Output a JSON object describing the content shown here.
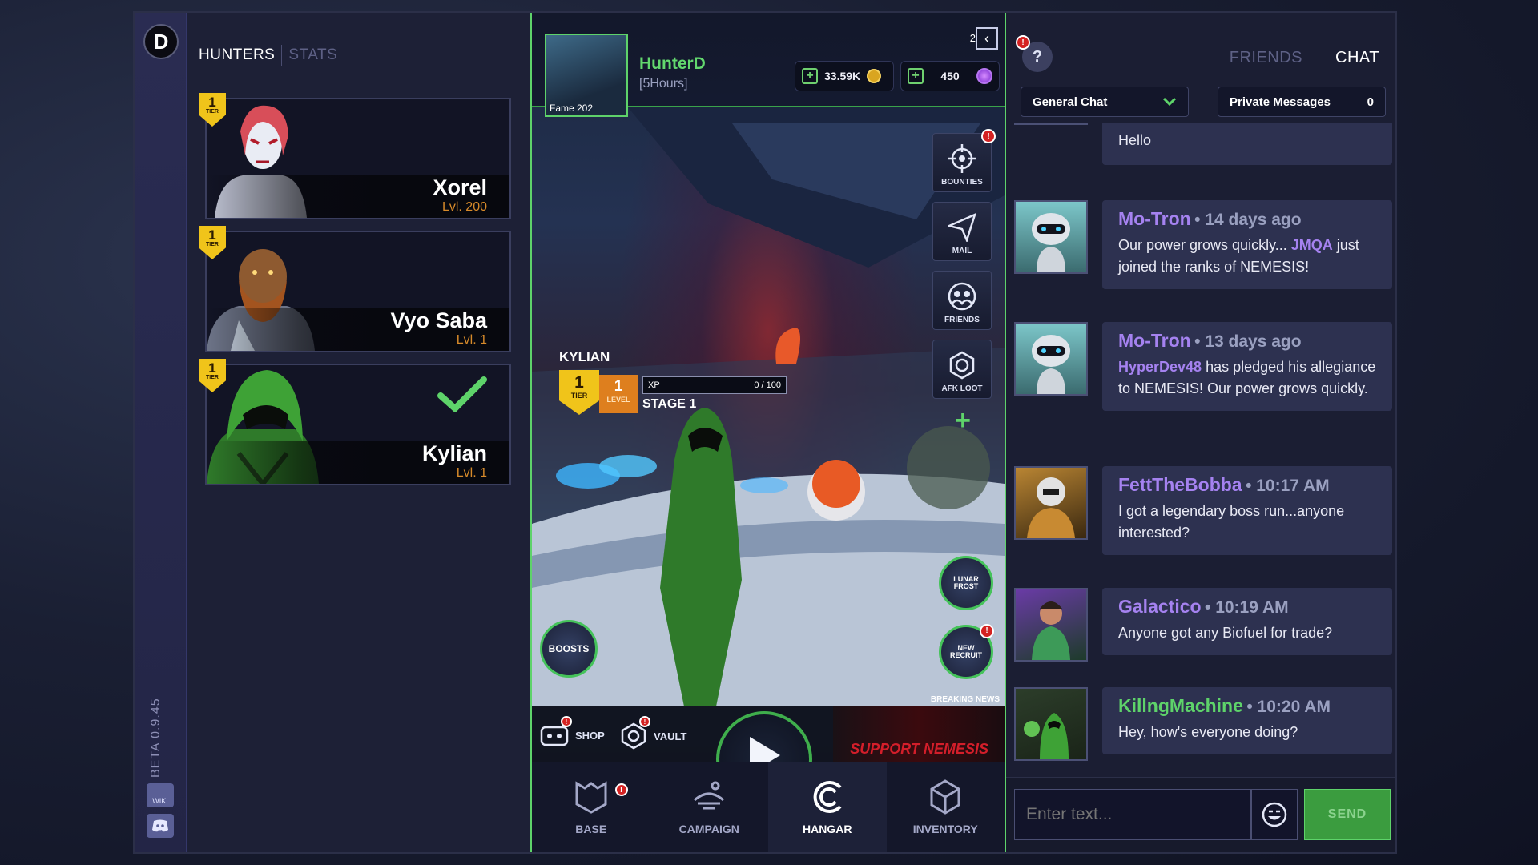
{
  "rail": {
    "version": "BETA 0.9.45",
    "wiki_label": "WIKI"
  },
  "hunters_panel": {
    "tabs": [
      {
        "label": "HUNTERS"
      },
      {
        "label": "STATS"
      }
    ],
    "hunters": [
      {
        "name": "Xorel",
        "level": "Lvl. 200",
        "tier": "1",
        "tier_label": "TIER",
        "selected": false
      },
      {
        "name": "Vyo Saba",
        "level": "Lvl. 1",
        "tier": "1",
        "tier_label": "TIER",
        "selected": false
      },
      {
        "name": "Kylian",
        "level": "Lvl. 1",
        "tier": "1",
        "tier_label": "TIER",
        "selected": true
      }
    ]
  },
  "game": {
    "player": {
      "name": "HunterD",
      "subtitle": "[5Hours]",
      "fame": "Fame 202"
    },
    "notification_count": "2",
    "currency": {
      "credits": "33.59K",
      "gems": "450"
    },
    "side_buttons": [
      {
        "label": "BOUNTIES",
        "icon": "crosshair-icon",
        "badge": "!"
      },
      {
        "label": "MAIL",
        "icon": "paper-plane-icon"
      },
      {
        "label": "FRIENDS",
        "icon": "friends-icon"
      },
      {
        "label": "AFK LOOT",
        "icon": "hexagon-loot-icon"
      }
    ],
    "active_hunter": {
      "name": "KYLIAN",
      "tier": "1",
      "tier_label": "TIER",
      "level": "1",
      "level_label": "LEVEL",
      "xp_label": "XP",
      "xp_value": "0 / 100",
      "stage": "STAGE 1"
    },
    "round_buttons": [
      {
        "label": "BOOSTS"
      },
      {
        "label": "LUNAR FROST"
      },
      {
        "label": "NEW RECRUIT",
        "badge": "!"
      }
    ],
    "breaking_news": "BREAKING NEWS",
    "shop_label": "SHOP",
    "vault_label": "VAULT",
    "promo_text": "SUPPORT NEMESIS",
    "nav": [
      {
        "label": "BASE",
        "icon": "base-icon",
        "badge": "!"
      },
      {
        "label": "CAMPAIGN",
        "icon": "campaign-icon"
      },
      {
        "label": "HANGAR",
        "icon": "hangar-icon",
        "active": true
      },
      {
        "label": "INVENTORY",
        "icon": "inventory-icon"
      }
    ]
  },
  "chat": {
    "help_badge": "!",
    "tabs": [
      {
        "label": "FRIENDS"
      },
      {
        "label": "CHAT"
      }
    ],
    "channel": "General Chat",
    "private_messages": {
      "label": "Private Messages",
      "count": "0"
    },
    "messages": [
      {
        "user": "",
        "time": "",
        "text": "Hello"
      },
      {
        "user": "Mo-Tron",
        "time": "14 days ago",
        "text_pre": "Our power grows quickly... ",
        "highlight": "JMQA",
        "text_post": " just joined the ranks of NEMESIS!"
      },
      {
        "user": "Mo-Tron",
        "time": "13 days ago",
        "text_pre": "",
        "highlight": "HyperDev48",
        "text_post": " has pledged his allegiance to NEMESIS! Our power grows quickly."
      },
      {
        "user": "FettTheBobba",
        "time": "10:17 AM",
        "text": "I got a legendary boss run...anyone interested?"
      },
      {
        "user": "Galactico",
        "time": "10:19 AM",
        "text": "Anyone got any Biofuel for trade?"
      },
      {
        "user": "KillngMachine",
        "time": "10:20 AM",
        "text": "Hey, how's everyone doing?"
      }
    ],
    "input_placeholder": "Enter text...",
    "send_label": "SEND"
  }
}
